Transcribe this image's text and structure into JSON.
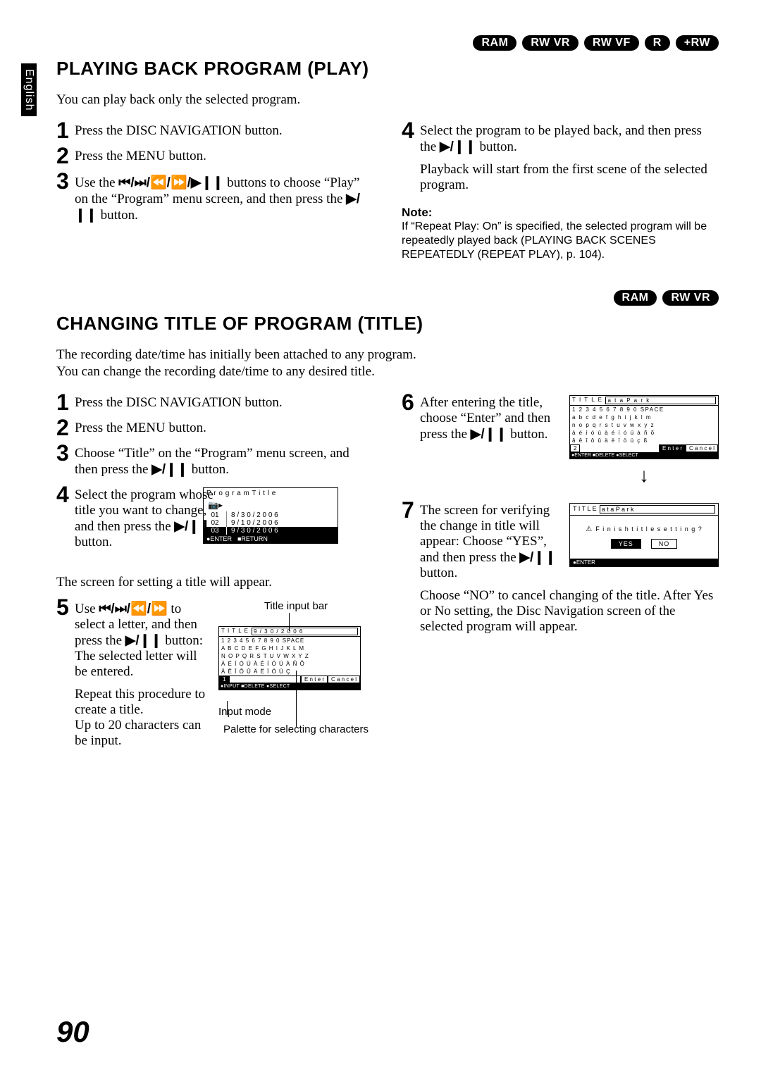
{
  "side_tab": "English",
  "badges_top": [
    "RAM",
    "RW VR",
    "RW VF",
    "R",
    "+RW"
  ],
  "section1": {
    "title": "PLAYING BACK PROGRAM (PLAY)",
    "intro": "You can play back only the selected program.",
    "left": {
      "s1": "Press the DISC NAVIGATION button.",
      "s2": "Press the MENU button.",
      "s3a": "Use the ",
      "s3b": " buttons to choose “Play” on the “Program” menu screen, and then press the ",
      "s3c": " button.",
      "icons3": "⏮/⏭/⏪/⏩/▶❙❙",
      "playpause": "▶/❙❙"
    },
    "right": {
      "s4a": "Select the program to be played back, and then press the ",
      "s4b": " button.",
      "s4para": "Playback will start from the first scene of the selected program.",
      "note_head": "Note:",
      "note_body": "If “Repeat Play: On” is specified, the selected program will be repeatedly played back (PLAYING BACK SCENES REPEATEDLY (REPEAT PLAY), p. 104)."
    }
  },
  "badges_mid": [
    "RAM",
    "RW VR"
  ],
  "section2": {
    "title": "CHANGING TITLE OF PROGRAM (TITLE)",
    "intro1": "The recording date/time has initially been attached to any program.",
    "intro2": "You can change the recording date/time to any desired title.",
    "left": {
      "s1": "Press the DISC NAVIGATION button.",
      "s2": "Press the MENU button.",
      "s3a": "Choose “Title” on the “Program” menu screen, and then press the ",
      "s3b": " button.",
      "s4a": "Select the program whose title you want to change, and then press the ",
      "s4b": " button.",
      "s4para": "The screen for setting a title will appear.",
      "s5a": "Use ",
      "s5b": " to select a letter, and then press the ",
      "s5c": " button: The selected letter will be entered.",
      "s5para": "Repeat this procedure to create a title.\nUp to 20 characters can be input.",
      "icons5": "⏮/⏭/⏪/⏩",
      "playpause": "▶/❙❙"
    },
    "right": {
      "s6a": "After entering the title, choose “Enter” and then press the ",
      "s6b": " button.",
      "s7a": "The screen for verifying the change in title will appear: Choose “YES”, and then press the ",
      "s7b": " button.",
      "para": "Choose “NO” to cancel changing of the title. After Yes or No setting, the Disc Navigation screen of the selected program will appear."
    },
    "prog_box": {
      "header": "P r o g r a m  T i t l e",
      "rows": [
        {
          "n": "01",
          "d": "8 / 3 0 / 2 0 0 6"
        },
        {
          "n": "02",
          "d": "9 / 1 0 / 2 0 0 6"
        },
        {
          "n": "03",
          "d": "9 / 3 0 / 2 0 0 6"
        }
      ],
      "footer_enter": "●ENTER",
      "footer_return": "■RETURN"
    },
    "title_diag": {
      "label_top": "Title input bar",
      "label_mode": "Input mode",
      "label_palette": "Palette for selecting characters",
      "box": {
        "title_row": "T I T L E",
        "value": "9 / 3 0 / 2 0 0 6",
        "row1": "1 2 3 4 5 6 7 8 9 0 SPACE",
        "row2": "A B C D E F G H I J K L M",
        "row3": "N O P Q R S T U V W X Y Z",
        "row4": "À É Í Ó Ú À É Í Ó Ú À Ñ Õ",
        "row5": "Â Ê Î Ô Û Ä Ë Ï Ö Ü Ç",
        "mode1": "1",
        "mode2": "E n t e r",
        "mode3": "C a n c e l",
        "footer": "●INPUT ■DELETE  ●SELECT"
      }
    },
    "kp_box": {
      "title_row": "T I T L E",
      "value": "a t  a  P a r k",
      "row1": "1 2 3 4 5 6 7 8 9 0 SPACE",
      "row2": "a b c d e f g h i j k l m",
      "row3": "n o p q r s t u v w x y z",
      "row4": "à é í ó ú à é í ó ú à ñ õ",
      "row5": "â ê î ô û ä ë ï ö ü ç ß",
      "mode1": "2",
      "mode2": "E n t e r",
      "mode3": "C a n c e l",
      "footer": "●ENTER ■DELETE  ●SELECT"
    },
    "verify_box": {
      "title_row": "T I T L E",
      "value": "a t  a  P a r k",
      "question": "F i n i s h  t i t l e  s e t t i n g ?",
      "yes": "YES",
      "no": "NO",
      "footer": "●ENTER"
    }
  },
  "page_number": "90"
}
